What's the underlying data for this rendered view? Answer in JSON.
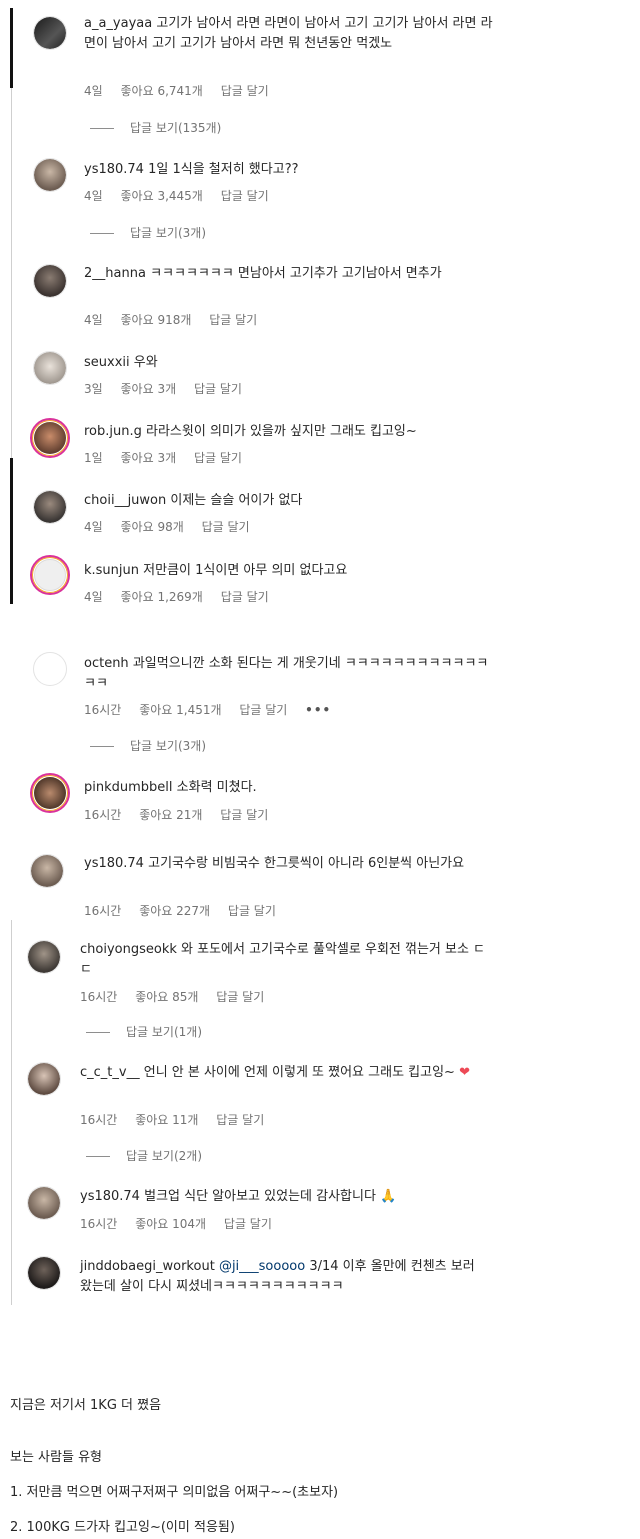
{
  "comments": [
    {
      "user": "a_a_yayaa",
      "text": "고기가 남아서 라면 라면이 남아서 고기 고기가 남아서 라면 라면이 남아서 고기 고기가 남아서 라면 뭐 천년동안 먹겠노",
      "time": "4일",
      "likes": "좋아요 6,741개",
      "reply": "답글 달기",
      "view_replies": "답글 보기(135개)"
    },
    {
      "user": "ys180.74",
      "text": "1일 1식을 철저히 했다고??",
      "time": "4일",
      "likes": "좋아요 3,445개",
      "reply": "답글 달기",
      "view_replies": "답글 보기(3개)"
    },
    {
      "user": "2__hanna",
      "text": "ㅋㅋㅋㅋㅋㅋㅋ 면남아서 고기추가 고기남아서 면추가",
      "time": "4일",
      "likes": "좋아요 918개",
      "reply": "답글 달기"
    },
    {
      "user": "seuxxii",
      "text": "우와",
      "time": "3일",
      "likes": "좋아요 3개",
      "reply": "답글 달기"
    },
    {
      "user": "rob.jun.g",
      "text": "라라스윗이 의미가 있을까 싶지만 그래도 킵고잉~",
      "time": "1일",
      "likes": "좋아요 3개",
      "reply": "답글 달기"
    },
    {
      "user": "choii__juwon",
      "text": "이제는 슬슬 어이가 없다",
      "time": "4일",
      "likes": "좋아요 98개",
      "reply": "답글 달기"
    },
    {
      "user": "k.sunjun",
      "text": "저만큼이 1식이면 아무 의미 없다고요",
      "time": "4일",
      "likes": "좋아요 1,269개",
      "reply": "답글 달기"
    },
    {
      "user": "octenh",
      "text": "과일먹으니깐 소화 된다는 게 개웃기네 ㅋㅋㅋㅋㅋㅋㅋㅋㅋㅋㅋㅋㅋㅋ",
      "time": "16시간",
      "likes": "좋아요 1,451개",
      "reply": "답글 달기",
      "more": "•••",
      "view_replies": "답글 보기(3개)"
    },
    {
      "user": "pinkdumbbell",
      "text": "소화력 미쳤다.",
      "time": "16시간",
      "likes": "좋아요 21개",
      "reply": "답글 달기"
    },
    {
      "user": "ys180.74",
      "text": "고기국수랑 비빔국수 한그릇씩이 아니라 6인분씩 아닌가요",
      "time": "16시간",
      "likes": "좋아요 227개",
      "reply": "답글 달기"
    },
    {
      "user": "choiyongseokk",
      "text": "와 포도에서 고기국수로 풀악셀로 우회전 꺾는거 보소 ㄷㄷ",
      "time": "16시간",
      "likes": "좋아요 85개",
      "reply": "답글 달기",
      "view_replies": "답글 보기(1개)"
    },
    {
      "user": "c_c_t_v__",
      "text": "언니 안 본 사이에 언제 이렇게 또 쪘어요 그래도 킵고잉~",
      "heart": "❤",
      "time": "16시간",
      "likes": "좋아요 11개",
      "reply": "답글 달기",
      "view_replies": "답글 보기(2개)"
    },
    {
      "user": "ys180.74",
      "text": "벌크업 식단 알아보고 있었는데 감사합니다",
      "emoji": "🙏",
      "time": "16시간",
      "likes": "좋아요 104개",
      "reply": "답글 달기"
    },
    {
      "user": "jinddobaegi_workout",
      "mention": "@ji___sooooo",
      "text": "3/14 이후 올만에 컨첸츠 보러 왔는데 살이 다시 찌셨네ㅋㅋㅋㅋㅋㅋㅋㅋㅋㅋㅋ"
    }
  ],
  "post": {
    "line1": "지금은 저기서 1KG 더 쪘음",
    "line2": "보는 사람들 유형",
    "line3": "1. 저만큼 먹으면 어쩌구저쩌구 의미없음 어쩌구~~(초보자)",
    "line4": "2. 100KG 드가자 킵고잉~(이미 적응됨)"
  },
  "colors": {
    "text": "#262626",
    "muted": "#737373",
    "mention": "#00376b",
    "story_ring": "#d9329b"
  }
}
